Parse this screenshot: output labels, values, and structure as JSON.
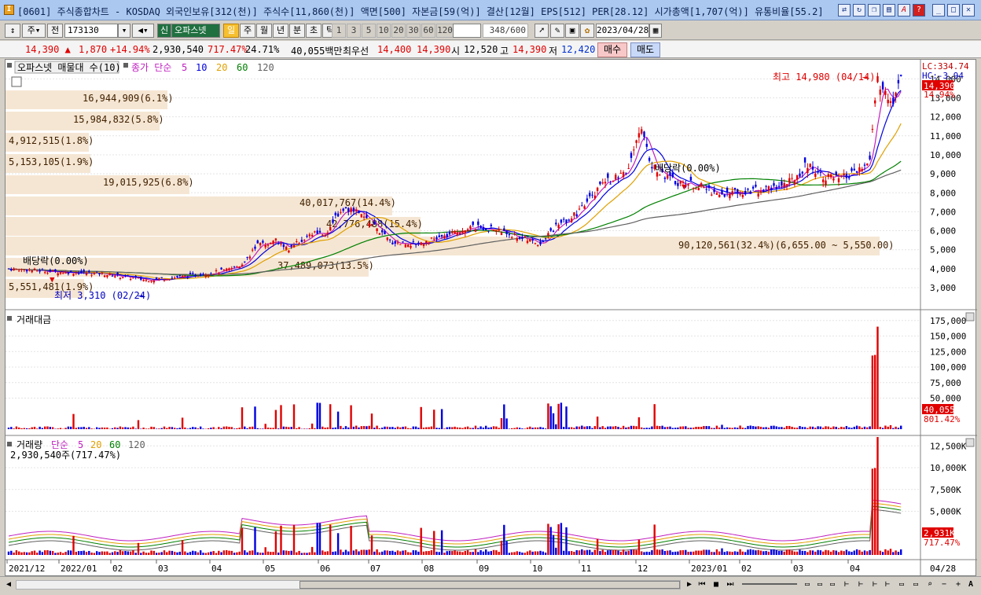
{
  "window": {
    "title": "[0601] 주식종합차트 - KOSDAQ 외국인보유[312(천)] 주식수[11,860(천)] 액면[500] 자본금[59(억)] 결산[12월] EPS[512] PER[28.12] 시가총액[1,707(억)] 유통비율[55.2]",
    "app_icon": "I"
  },
  "toolbar": {
    "period": "주",
    "all": "전",
    "code": "173130",
    "stock_name": "오파스넷",
    "sin": "신",
    "intervals": [
      "일",
      "주",
      "월",
      "년",
      "분",
      "초",
      "틱"
    ],
    "active_interval": "일",
    "minutes": [
      "1",
      "3",
      "5",
      "10",
      "20",
      "30",
      "60",
      "120"
    ],
    "count_value": "348",
    "count_total": "/600",
    "date": "2023/04/28"
  },
  "price_bar": {
    "price": "14,390",
    "change_arrow": "▲",
    "change": "1,870",
    "change_pct": "+14.94%",
    "volume": "2,930,540",
    "volume_ratio": "717.47%",
    "turnover": "24.71%",
    "amount": "40,055백만",
    "best_label": "최우선",
    "ask": "14,400",
    "bid": "14,390",
    "open_label": "시",
    "open": "12,520",
    "high_label": "고",
    "high": "14,390",
    "low_label": "저",
    "low": "12,420",
    "buy": "매수",
    "sell": "매도"
  },
  "price_panel": {
    "legend_name": "오파스넷 매물대 수(10)",
    "legend_ma": "종가 단순",
    "ma_periods": [
      "5",
      "10",
      "20",
      "60",
      "120"
    ],
    "ma_colors": [
      "#c020c0",
      "#0000e0",
      "#e0a000",
      "#008000",
      "#606060"
    ],
    "scale_lc": "LC:334.74",
    "scale_hc": "HC:-3.94",
    "y_ticks": [
      "14,000",
      "13,000",
      "12,000",
      "11,000",
      "10,000",
      "9,000",
      "8,000",
      "7,000",
      "6,000",
      "5,000",
      "4,000",
      "3,000"
    ],
    "cur_price": "14,390",
    "cur_pct": "14.94%",
    "profile": [
      "16,944,909(6.1%)",
      "15,984,832(5.8%)",
      "4,912,515(1.8%)",
      "5,153,105(1.9%)",
      "19,015,925(6.8%)",
      "40,017,767(14.4%)",
      "42,776,488(15.4%)",
      "90,120,561(32.4%)(6,655.00 ~ 5,550.00)",
      "37,489,073(13.5%)",
      "5,551,481(1.9%)"
    ],
    "high_note": "최고 14,980 (04/14)",
    "low_note": "최저 3,310 (02/24)",
    "div1": "배당락(0.00%)",
    "div2": "배당락(0.00%)"
  },
  "amount_panel": {
    "legend": "거래대금",
    "y_ticks": [
      "175,000",
      "150,000",
      "125,000",
      "100,000",
      "75,000",
      "50,000"
    ],
    "cur": "40,055",
    "pct": "801.42%"
  },
  "volume_panel": {
    "legend": "거래량",
    "legend_ma": "단순",
    "ma_periods": [
      "5",
      "20",
      "60",
      "120"
    ],
    "sub": "2,930,540주(717.47%)",
    "y_ticks": [
      "12,500K",
      "10,000K",
      "7,500K",
      "5,000K"
    ],
    "cur": "2,931K",
    "pct": "717.47%"
  },
  "x_axis": [
    "2021/12",
    "2022/01",
    "02",
    "03",
    "04",
    "05",
    "06",
    "07",
    "08",
    "09",
    "10",
    "11",
    "12",
    "2023/01",
    "02",
    "03",
    "04"
  ],
  "x_end": "04/28",
  "colors": {
    "up": "#e00000",
    "down": "#0000e0",
    "profile": "#f5e6d3"
  }
}
